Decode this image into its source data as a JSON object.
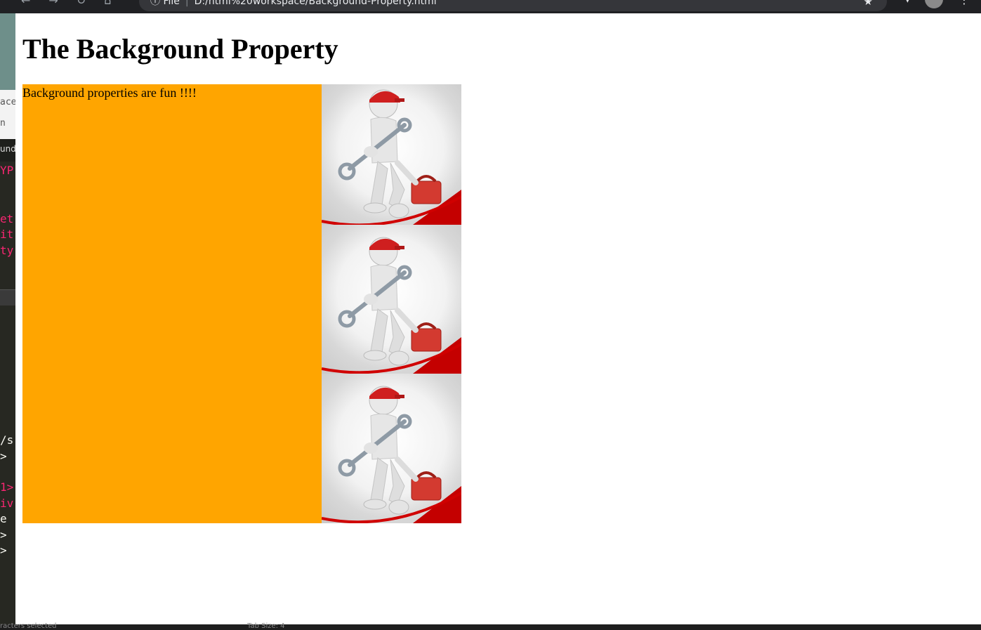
{
  "browser": {
    "address_scheme": "File",
    "address_path": "D:/html%20workspace/Background-Property.html",
    "icons": [
      "back-icon",
      "forward-icon",
      "reload-icon",
      "home-icon",
      "info-icon",
      "star-icon",
      "extension-icon",
      "profile-avatar",
      "menu-icon"
    ]
  },
  "editor_background": {
    "panel_lines": [
      "ace",
      "n"
    ],
    "tab_fragment": "und-",
    "code_fragments": [
      "YP",
      "et",
      "it",
      "ty",
      "/s",
      ">",
      "1>",
      "iv",
      "e",
      ">",
      ">"
    ],
    "status_left": "racters selected",
    "status_right": "Tab Size: 4"
  },
  "page": {
    "title": "The Background Property",
    "box_text": "Background properties are fun !!!!",
    "box_color": "#ffa500",
    "background_image": "mechanic-with-wrench-and-toolbox",
    "background_repeat": "repeat-y",
    "background_position": "right",
    "tile_count": 3
  }
}
